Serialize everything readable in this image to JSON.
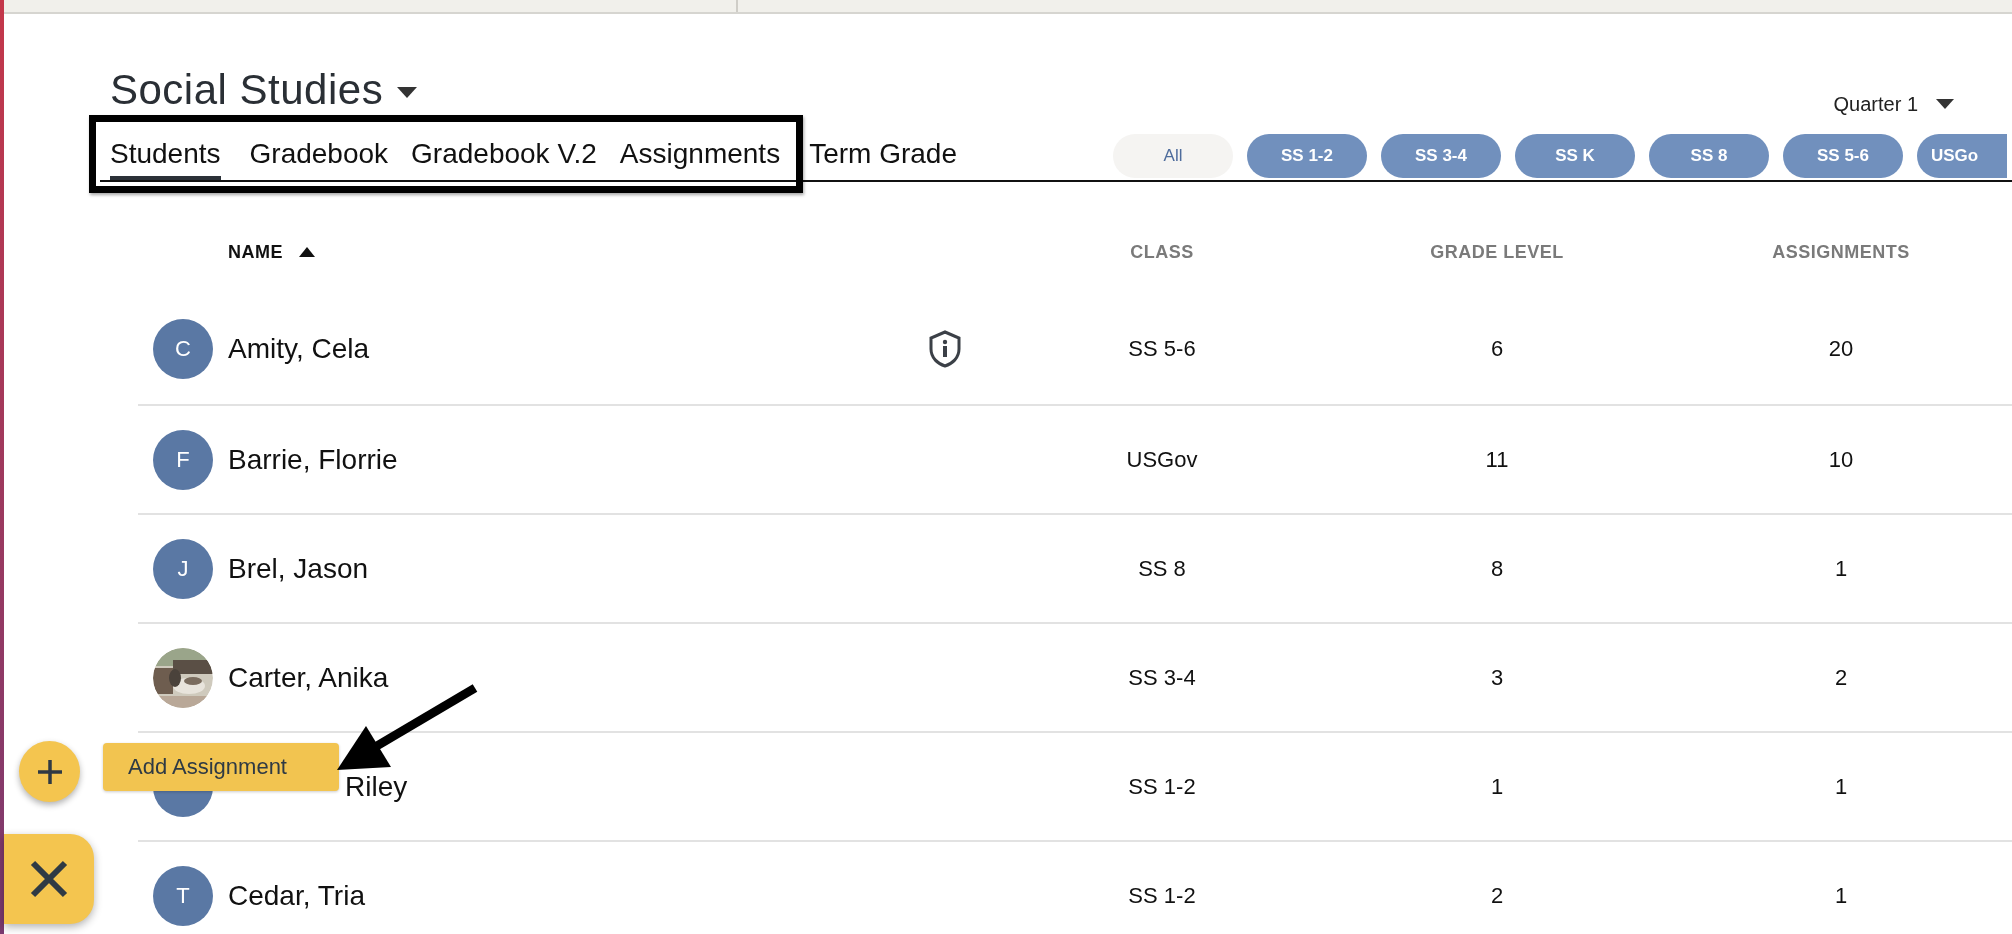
{
  "course": {
    "title": "Social Studies"
  },
  "term": {
    "label": "Quarter 1"
  },
  "tabs": [
    {
      "label": "Students",
      "selected": true
    },
    {
      "label": "Gradebook",
      "selected": false
    },
    {
      "label": "Gradebook V.2",
      "selected": false
    },
    {
      "label": "Assignments",
      "selected": false
    },
    {
      "label": "Term Grade",
      "selected": false
    }
  ],
  "filters": [
    {
      "label": "All",
      "selected": true
    },
    {
      "label": "SS 1-2",
      "selected": false
    },
    {
      "label": "SS 3-4",
      "selected": false
    },
    {
      "label": "SS K",
      "selected": false
    },
    {
      "label": "SS 8",
      "selected": false
    },
    {
      "label": "SS 5-6",
      "selected": false
    },
    {
      "label": "USGo",
      "selected": false
    }
  ],
  "table": {
    "columns": [
      {
        "label": "NAME",
        "sorted": true
      },
      {
        "label": "CLASS",
        "sorted": false
      },
      {
        "label": "GRADE LEVEL",
        "sorted": false
      },
      {
        "label": "ASSIGNMENTS",
        "sorted": false
      }
    ],
    "rows": [
      {
        "avatar": {
          "kind": "letter",
          "initial": "C"
        },
        "name": "Amity, Cela",
        "alert": true,
        "class": "SS 5-6",
        "grade_level": "6",
        "assignments": "20"
      },
      {
        "avatar": {
          "kind": "letter",
          "initial": "F"
        },
        "name": "Barrie, Florrie",
        "alert": false,
        "class": "USGov",
        "grade_level": "11",
        "assignments": "10"
      },
      {
        "avatar": {
          "kind": "letter",
          "initial": "J"
        },
        "name": "Brel, Jason",
        "alert": false,
        "class": "SS 8",
        "grade_level": "8",
        "assignments": "1"
      },
      {
        "name": "Carter, Anika",
        "alert": false,
        "class": "SS 3-4",
        "grade_level": "3",
        "assignments": "2"
      },
      {
        "avatar": {
          "kind": "letter"
        },
        "name": "Riley",
        "covered": true,
        "alert": false,
        "class": "SS 1-2",
        "grade_level": "1",
        "assignments": "1"
      },
      {
        "avatar": {
          "kind": "letter",
          "initial": "T"
        },
        "name": "Cedar, Tria",
        "alert": false,
        "class": "SS 1-2",
        "grade_level": "2",
        "assignments": "1"
      }
    ]
  },
  "actions": {
    "add_tooltip": "Add Assignment",
    "menu_open": true
  }
}
